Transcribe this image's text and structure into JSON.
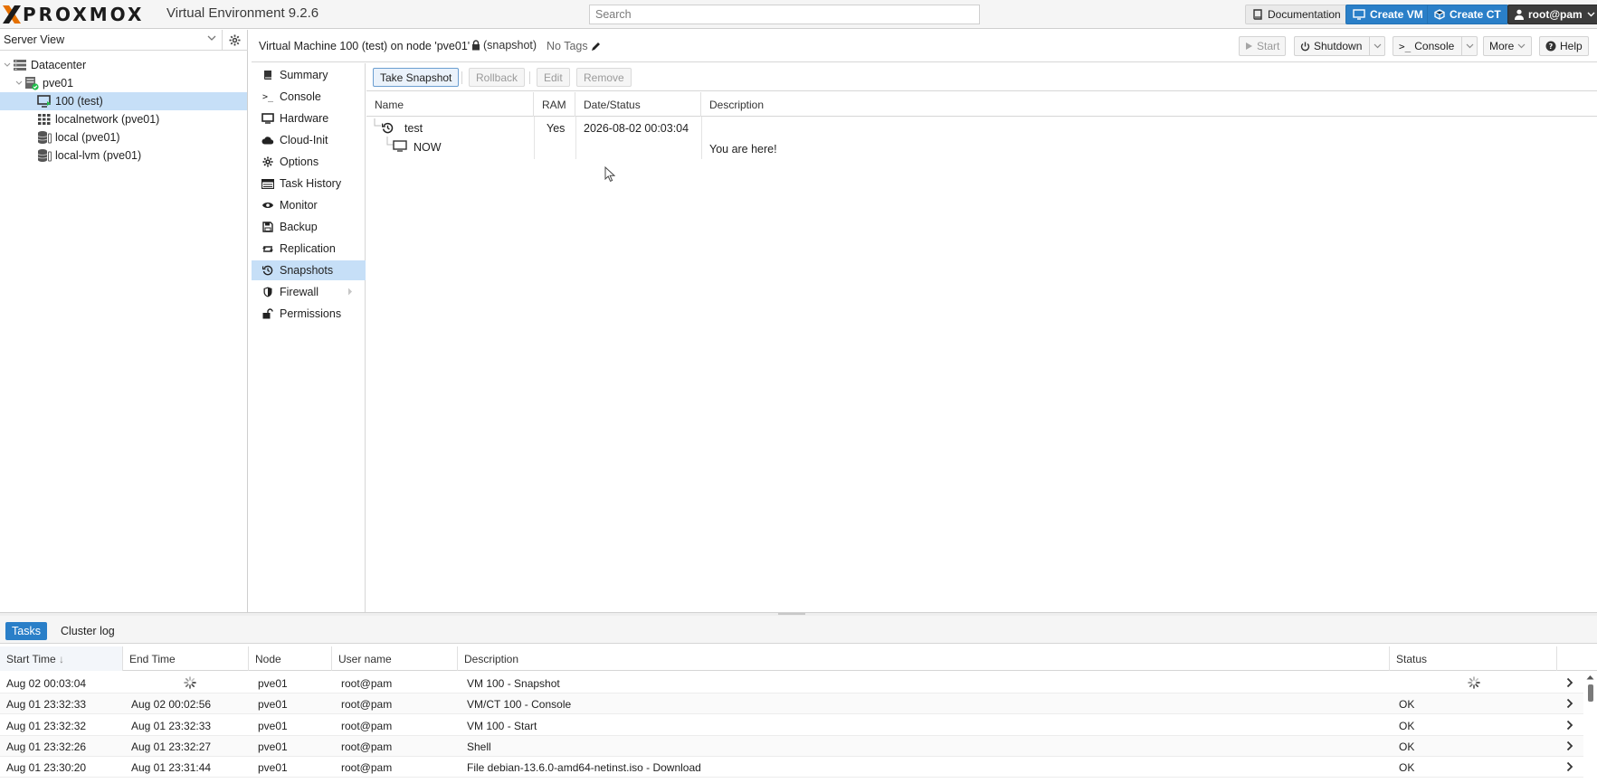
{
  "topbar": {
    "logo_text": "PROXMOX",
    "product": "Virtual Environment 9.2.6",
    "search_placeholder": "Search",
    "documentation": "Documentation",
    "create_vm": "Create VM",
    "create_ct": "Create CT",
    "user": "root@pam"
  },
  "left": {
    "view": "Server View",
    "tree": [
      {
        "label": "Datacenter",
        "icon": "datacenter-icon"
      },
      {
        "label": "pve01",
        "icon": "node-online-icon"
      },
      {
        "label": "100 (test)",
        "icon": "vm-running-icon",
        "selected": true
      },
      {
        "label": "localnetwork (pve01)",
        "icon": "network-grid-icon"
      },
      {
        "label": "local (pve01)",
        "icon": "storage-icon"
      },
      {
        "label": "local-lvm (pve01)",
        "icon": "storage-icon"
      }
    ]
  },
  "header": {
    "title": "Virtual Machine 100 (test) on node 'pve01'",
    "lock": "(snapshot)",
    "tags": "No Tags",
    "start": "Start",
    "shutdown": "Shutdown",
    "console": "Console",
    "more": "More",
    "help": "Help"
  },
  "nav": [
    {
      "label": "Summary",
      "icon": "book-icon"
    },
    {
      "label": "Console",
      "icon": "terminal-icon"
    },
    {
      "label": "Hardware",
      "icon": "monitor-icon"
    },
    {
      "label": "Cloud-Init",
      "icon": "cloud-icon"
    },
    {
      "label": "Options",
      "icon": "gear-icon"
    },
    {
      "label": "Task History",
      "icon": "list-icon"
    },
    {
      "label": "Monitor",
      "icon": "eye-icon"
    },
    {
      "label": "Backup",
      "icon": "floppy-icon"
    },
    {
      "label": "Replication",
      "icon": "retweet-icon"
    },
    {
      "label": "Snapshots",
      "icon": "history-icon",
      "active": true
    },
    {
      "label": "Firewall",
      "icon": "shield-icon"
    },
    {
      "label": "Permissions",
      "icon": "unlock-icon"
    }
  ],
  "snapshots": {
    "toolbar": {
      "take": "Take Snapshot",
      "rollback": "Rollback",
      "edit": "Edit",
      "remove": "Remove"
    },
    "columns": [
      "Name",
      "RAM",
      "Date/Status",
      "Description"
    ],
    "rows": [
      {
        "name": "test",
        "ram": "Yes",
        "date": "2026-08-02 00:03:04",
        "description": ""
      },
      {
        "name": "NOW",
        "ram": "",
        "date": "",
        "description": "You are here!"
      }
    ]
  },
  "tasks": {
    "tabs": [
      "Tasks",
      "Cluster log"
    ],
    "columns": [
      "Start Time",
      "End Time",
      "Node",
      "User name",
      "Description",
      "Status"
    ],
    "sort_arrow": "↓",
    "rows": [
      {
        "start": "Aug 02 00:03:04",
        "end": "",
        "running": true,
        "node": "pve01",
        "user": "root@pam",
        "desc": "VM 100 - Snapshot",
        "status": ""
      },
      {
        "start": "Aug 01 23:32:33",
        "end": "Aug 02 00:02:56",
        "running": false,
        "node": "pve01",
        "user": "root@pam",
        "desc": "VM/CT 100 - Console",
        "status": "OK"
      },
      {
        "start": "Aug 01 23:32:32",
        "end": "Aug 01 23:32:33",
        "running": false,
        "node": "pve01",
        "user": "root@pam",
        "desc": "VM 100 - Start",
        "status": "OK"
      },
      {
        "start": "Aug 01 23:32:26",
        "end": "Aug 01 23:32:27",
        "running": false,
        "node": "pve01",
        "user": "root@pam",
        "desc": "Shell",
        "status": "OK"
      },
      {
        "start": "Aug 01 23:30:20",
        "end": "Aug 01 23:31:44",
        "running": false,
        "node": "pve01",
        "user": "root@pam",
        "desc": "File debian-13.6.0-amd64-netinst.iso - Download",
        "status": "OK"
      }
    ]
  },
  "colors": {
    "accent": "#2a7fc8",
    "selection": "#c6dff7",
    "logo_orange": "#e57000",
    "running_green": "#21bf4b"
  }
}
